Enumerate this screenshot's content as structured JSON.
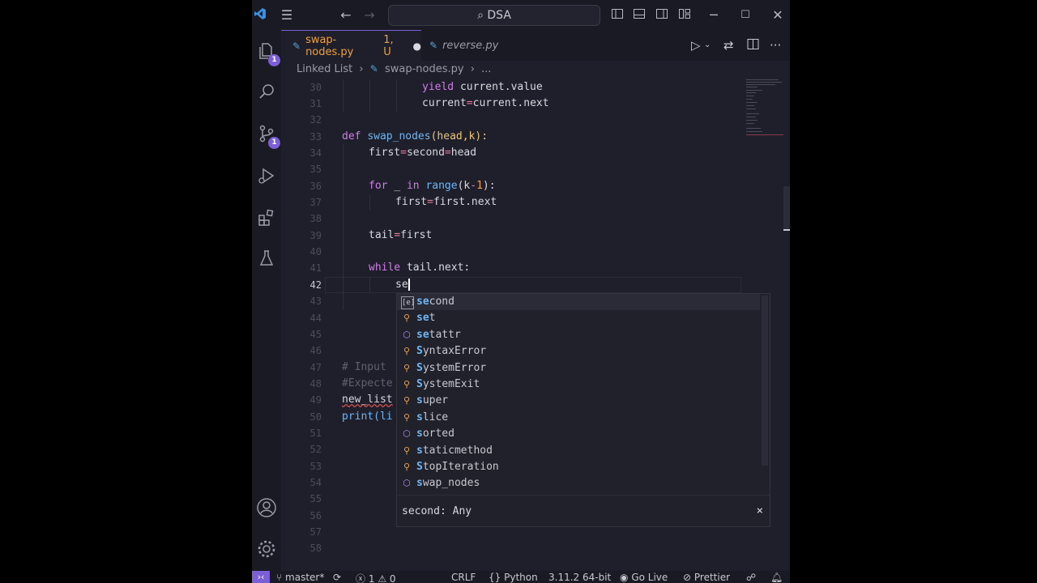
{
  "titlebar": {
    "search": "DSA"
  },
  "badges": {
    "explorer": "1",
    "source_control": "1"
  },
  "tabs": [
    {
      "label": "swap-nodes.py",
      "suffix": "1, U",
      "active": true,
      "dirty": true
    },
    {
      "label": "reverse.py",
      "active": false
    }
  ],
  "breadcrumb": {
    "folder": "Linked List",
    "file": "swap-nodes.py",
    "more": "..."
  },
  "editor": {
    "current_line": "42",
    "lines": [
      {
        "n": "30"
      },
      {
        "n": "31"
      },
      {
        "n": "32"
      },
      {
        "n": "33"
      },
      {
        "n": "34"
      },
      {
        "n": "35"
      },
      {
        "n": "36"
      },
      {
        "n": "37"
      },
      {
        "n": "38"
      },
      {
        "n": "39"
      },
      {
        "n": "40"
      },
      {
        "n": "41"
      },
      {
        "n": "42"
      },
      {
        "n": "43"
      },
      {
        "n": "44"
      },
      {
        "n": "45"
      },
      {
        "n": "46"
      },
      {
        "n": "47"
      },
      {
        "n": "48"
      },
      {
        "n": "49"
      },
      {
        "n": "50"
      },
      {
        "n": "51"
      },
      {
        "n": "52"
      },
      {
        "n": "53"
      },
      {
        "n": "54"
      },
      {
        "n": "55"
      },
      {
        "n": "56"
      },
      {
        "n": "57"
      },
      {
        "n": "58"
      }
    ],
    "code": {
      "l30": [
        "yield",
        "current.value"
      ],
      "l31": [
        "current",
        "=",
        "current.next"
      ],
      "l33": [
        "def",
        "swap_nodes",
        "(head,k):"
      ],
      "l34": [
        "first",
        "=",
        "second",
        "=",
        "head"
      ],
      "l36": [
        "for",
        "_",
        "in",
        "range",
        "(k",
        "-",
        "1",
        "):"
      ],
      "l37": [
        "first",
        "=",
        "first.next"
      ],
      "l39": [
        "tail",
        "=",
        "first"
      ],
      "l41": [
        "while",
        "tail.next:"
      ],
      "l42": [
        "se"
      ],
      "l47": "# Input",
      "l48": "#Expecte",
      "l49": "new_list",
      "l50": "print(li"
    }
  },
  "suggest": {
    "items": [
      {
        "pre": "",
        "hl": "se",
        "post": "cond",
        "icon": "variable",
        "selected": true
      },
      {
        "pre": "",
        "hl": "se",
        "post": "t",
        "icon": "class"
      },
      {
        "pre": "",
        "hl": "se",
        "post": "tattr",
        "icon": "function"
      },
      {
        "pre": "",
        "hl": "S",
        "post": "yntaxError",
        "hl2": "",
        "icon": "class"
      },
      {
        "pre": "",
        "hl": "S",
        "post": "ystemError",
        "icon": "class"
      },
      {
        "pre": "",
        "hl": "S",
        "post": "ystemExit",
        "icon": "class"
      },
      {
        "pre": "",
        "hl": "s",
        "post": "uper",
        "icon": "class"
      },
      {
        "pre": "",
        "hl": "s",
        "post": "lice",
        "icon": "class"
      },
      {
        "pre": "",
        "hl": "s",
        "post": "orted",
        "icon": "function"
      },
      {
        "pre": "",
        "hl": "s",
        "post": "taticmethod",
        "icon": "class"
      },
      {
        "pre": "",
        "hl": "S",
        "post": "topIteration",
        "icon": "class"
      },
      {
        "pre": "",
        "hl": "s",
        "post": "wap_nodes",
        "icon": "function"
      }
    ],
    "detail": "second: Any",
    "close": "×"
  },
  "statusbar": {
    "branch": "master*",
    "errors": "1",
    "warnings": "0",
    "eol": "CRLF",
    "language": "Python",
    "interpreter": "3.11.2 64-bit",
    "golive": "Go Live",
    "prettier": "Prettier"
  }
}
